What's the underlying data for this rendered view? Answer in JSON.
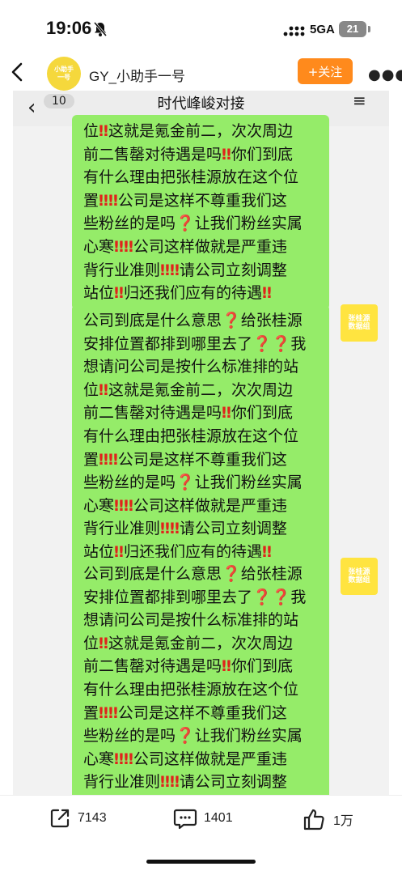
{
  "status_bar": {
    "time": "19:06",
    "network": "5GA",
    "battery": "21"
  },
  "header": {
    "username": "GY_小助手一号",
    "follow_label": "+关注",
    "avatar_text": [
      "小助手",
      "一号"
    ]
  },
  "chat": {
    "back_count": "10",
    "title": "时代峰峻对接",
    "menu": "≡",
    "msg_avatar_text": [
      "张桂源",
      "数据组"
    ],
    "message_text": "公司到底是什么意思❓给张桂源安排位置都排到哪里去了❓❓我想请问公司是按什么标准排的站位‼️这就是氪金前二，次次周边前二售罄对待遇是吗‼️你们到底有什么理由把张桂源放在这个位置‼️‼️公司是这样不尊重我们这些粉丝的是吗❓让我们粉丝实属心寒‼️‼️公司这样做就是严重违背行业准则‼️‼️请公司立刻调整站位‼️归还我们应有的待遇‼️",
    "message_lines": [
      "公司到底是什么意思",
      "给张桂源",
      "安排位置都排到哪里去了",
      "我",
      "想请问公司是按什么标准排的站",
      "位",
      "这就是氪金前二，次次周边",
      "前二售罄对待遇是吗",
      "你们到底",
      "有什么理由把张桂源放在这个位",
      "置",
      "公司是这样不尊重我们这",
      "些粉丝的是吗",
      "让我们粉丝实属",
      "心寒",
      "公司这样做就是严重违",
      "背行业准则",
      "请公司立刻调整",
      "站位",
      "归还我们应有的待遇"
    ],
    "marks": {
      "double_exclaim": "‼",
      "question": "❓"
    }
  },
  "bottom_bar": {
    "share_count": "7143",
    "comment_count": "1401",
    "like_count": "1万"
  }
}
